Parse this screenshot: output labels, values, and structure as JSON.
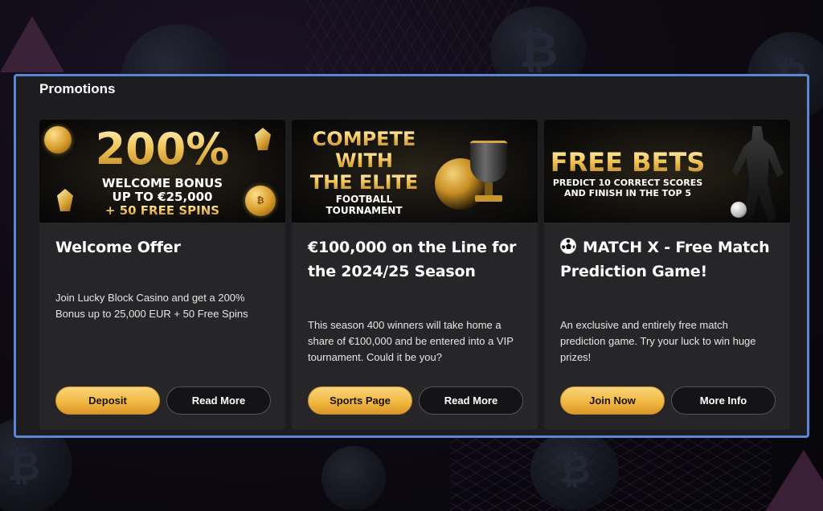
{
  "panel": {
    "title": "Promotions"
  },
  "cards": [
    {
      "banner": {
        "line1": "200%",
        "line2": "WELCOME BONUS",
        "line3": "UP TO €25,000",
        "line4": "+ 50 FREE SPINS"
      },
      "title": "Welcome Offer",
      "description": "Join Lucky Block Casino and get a 200% Bonus up to 25,000 EUR + 50 Free Spins",
      "primary_button": "Deposit",
      "secondary_button": "Read More"
    },
    {
      "banner": {
        "line1": "COMPETE",
        "line2": "WITH",
        "line3": "THE ELITE",
        "line4": "FOOTBALL",
        "line5": "TOURNAMENT"
      },
      "title": "€100,000 on the Line for the 2024/25 Season",
      "description": "This season 400 winners will take home a share of €100,000 and be entered into a VIP tournament. Could it be you?",
      "primary_button": "Sports Page",
      "secondary_button": "Read More"
    },
    {
      "banner": {
        "line1": "FREE BETS",
        "line2": "PREDICT 10 CORRECT SCORES",
        "line3": "AND FINISH IN THE TOP 5"
      },
      "title": "MATCH X - Free Match Prediction Game!",
      "description": "An exclusive and entirely free match prediction game. Try your luck to win huge prizes!",
      "primary_button": "Join Now",
      "secondary_button": "More Info"
    }
  ],
  "colors": {
    "panel_border": "#5b86d6",
    "button_gold": "#f0b53e",
    "card_bg": "#262629"
  }
}
